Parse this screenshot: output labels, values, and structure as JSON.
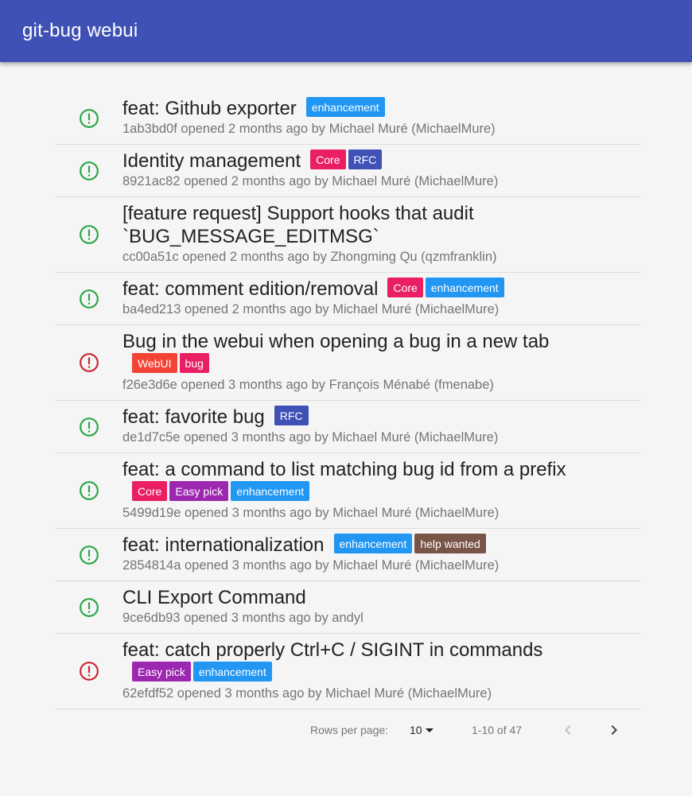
{
  "app": {
    "title": "git-bug webui"
  },
  "colors": {
    "appbar": "#3f51b5",
    "open": "#28a745",
    "closed": "#cb2431"
  },
  "bugs": [
    {
      "status": "open",
      "title": "feat: Github exporter",
      "labels": [
        {
          "name": "enhancement",
          "color": "#2196f3"
        }
      ],
      "meta": "1ab3bd0f opened 2 months ago by Michael Muré (MichaelMure)"
    },
    {
      "status": "open",
      "title": "Identity management",
      "labels": [
        {
          "name": "Core",
          "color": "#e91e63"
        },
        {
          "name": "RFC",
          "color": "#3f51b5"
        }
      ],
      "meta": "8921ac82 opened 2 months ago by Michael Muré (MichaelMure)"
    },
    {
      "status": "open",
      "title": "[feature request] Support hooks that audit `BUG_MESSAGE_EDITMSG`",
      "labels": [],
      "meta": "cc00a51c opened 2 months ago by Zhongming Qu (qzmfranklin)"
    },
    {
      "status": "open",
      "title": "feat: comment edition/removal",
      "labels": [
        {
          "name": "Core",
          "color": "#e91e63"
        },
        {
          "name": "enhancement",
          "color": "#2196f3"
        }
      ],
      "meta": "ba4ed213 opened 2 months ago by Michael Muré (MichaelMure)"
    },
    {
      "status": "closed",
      "title": "Bug in the webui when opening a bug in a new tab",
      "labels": [
        {
          "name": "WebUI",
          "color": "#f44336"
        },
        {
          "name": "bug",
          "color": "#e91e63"
        }
      ],
      "meta": "f26e3d6e opened 3 months ago by François Ménabé (fmenabe)"
    },
    {
      "status": "open",
      "title": "feat: favorite bug",
      "labels": [
        {
          "name": "RFC",
          "color": "#3f51b5"
        }
      ],
      "meta": "de1d7c5e opened 3 months ago by Michael Muré (MichaelMure)"
    },
    {
      "status": "open",
      "title": "feat: a command to list matching bug id from a prefix",
      "labels": [
        {
          "name": "Core",
          "color": "#e91e63"
        },
        {
          "name": "Easy pick",
          "color": "#9c27b0"
        },
        {
          "name": "enhancement",
          "color": "#2196f3"
        }
      ],
      "meta": "5499d19e opened 3 months ago by Michael Muré (MichaelMure)"
    },
    {
      "status": "open",
      "title": "feat: internationalization",
      "labels": [
        {
          "name": "enhancement",
          "color": "#2196f3"
        },
        {
          "name": "help wanted",
          "color": "#795548"
        }
      ],
      "meta": "2854814a opened 3 months ago by Michael Muré (MichaelMure)"
    },
    {
      "status": "open",
      "title": "CLI Export Command",
      "labels": [],
      "meta": "9ce6db93 opened 3 months ago by andyl"
    },
    {
      "status": "closed",
      "title": "feat: catch properly Ctrl+C / SIGINT in commands",
      "labels": [
        {
          "name": "Easy pick",
          "color": "#9c27b0"
        },
        {
          "name": "enhancement",
          "color": "#2196f3"
        }
      ],
      "meta": "62efdf52 opened 3 months ago by Michael Muré (MichaelMure)"
    }
  ],
  "pagination": {
    "rows_per_page_label": "Rows per page:",
    "rows_per_page_value": "10",
    "range": "1-10 of 47",
    "prev_icon": "chevron-left-icon",
    "next_icon": "chevron-right-icon"
  }
}
